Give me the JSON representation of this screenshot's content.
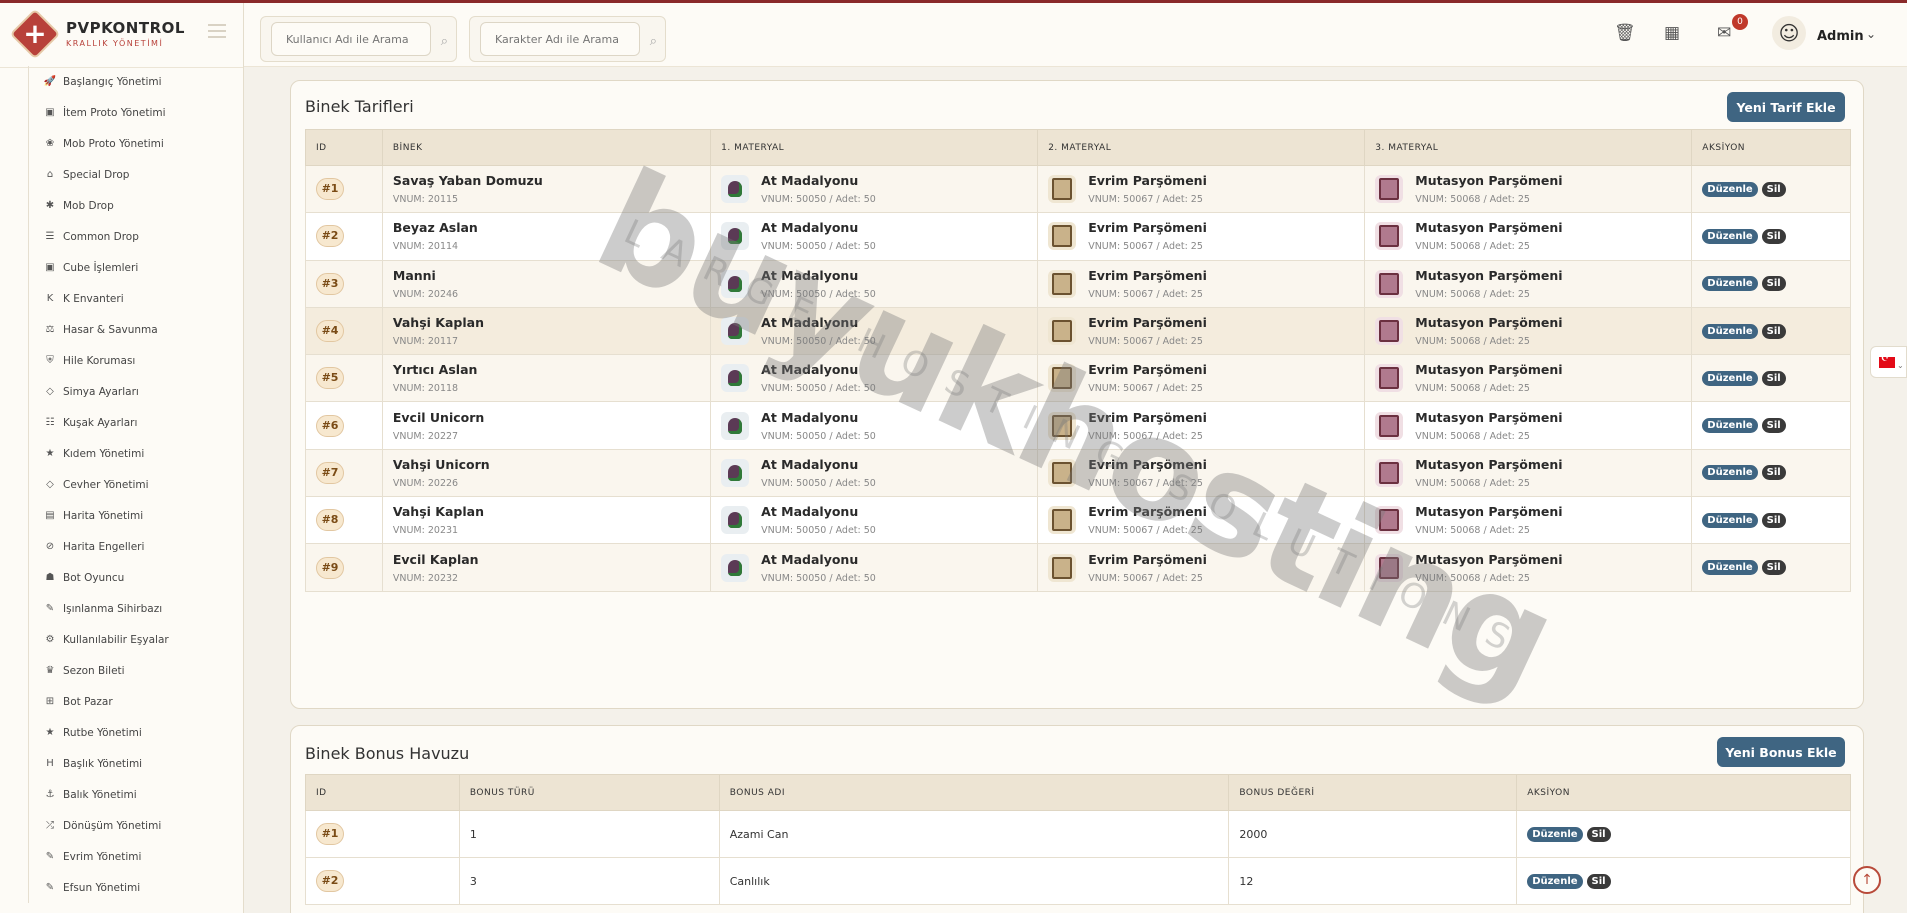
{
  "brand": {
    "name": "PVPKONTROL",
    "subtitle": "KRALLIK YÖNETİMİ"
  },
  "sidebar": {
    "items": [
      {
        "icon": "rocket-icon",
        "glyph": "🚀",
        "label": "Başlangıç Yönetimi"
      },
      {
        "icon": "box-icon",
        "glyph": "▣",
        "label": "İtem Proto Yönetimi"
      },
      {
        "icon": "paw-icon",
        "glyph": "❀",
        "label": "Mob Proto Yönetimi"
      },
      {
        "icon": "gift-icon",
        "glyph": "⌂",
        "label": "Special Drop"
      },
      {
        "icon": "bug-icon",
        "glyph": "✱",
        "label": "Mob Drop"
      },
      {
        "icon": "list-icon",
        "glyph": "☰",
        "label": "Common Drop"
      },
      {
        "icon": "cube-icon",
        "glyph": "▣",
        "label": "Cube İşlemleri"
      },
      {
        "icon": "k-icon",
        "glyph": "K",
        "label": "K Envanteri"
      },
      {
        "icon": "scale-icon",
        "glyph": "⚖",
        "label": "Hasar & Savunma"
      },
      {
        "icon": "shield-icon",
        "glyph": "⛨",
        "label": "Hile Koruması"
      },
      {
        "icon": "diamond-icon",
        "glyph": "◇",
        "label": "Simya Ayarları"
      },
      {
        "icon": "sliders-icon",
        "glyph": "☷",
        "label": "Kuşak Ayarları"
      },
      {
        "icon": "star-icon",
        "glyph": "★",
        "label": "Kıdem Yönetimi"
      },
      {
        "icon": "gem-icon",
        "glyph": "◇",
        "label": "Cevher Yönetimi"
      },
      {
        "icon": "map-icon",
        "glyph": "▤",
        "label": "Harita Yönetimi"
      },
      {
        "icon": "ban-icon",
        "glyph": "⊘",
        "label": "Harita Engelleri"
      },
      {
        "icon": "robot-icon",
        "glyph": "☗",
        "label": "Bot Oyuncu"
      },
      {
        "icon": "magic-wand-icon",
        "glyph": "✎",
        "label": "Işınlanma Sihirbazı"
      },
      {
        "icon": "cogs-icon",
        "glyph": "⚙",
        "label": "Kullanılabilir Eşyalar"
      },
      {
        "icon": "trophy-icon",
        "glyph": "♛",
        "label": "Sezon Bileti"
      },
      {
        "icon": "cart-icon",
        "glyph": "⊞",
        "label": "Bot Pazar"
      },
      {
        "icon": "star-icon",
        "glyph": "★",
        "label": "Rutbe Yönetimi"
      },
      {
        "icon": "heading-icon",
        "glyph": "H",
        "label": "Başlık Yönetimi"
      },
      {
        "icon": "anchor-icon",
        "glyph": "⚓",
        "label": "Balık Yönetimi"
      },
      {
        "icon": "random-icon",
        "glyph": "⤮",
        "label": "Dönüşüm Yönetimi"
      },
      {
        "icon": "wand-icon",
        "glyph": "✎",
        "label": "Evrim Yönetimi"
      },
      {
        "icon": "wand-icon",
        "glyph": "✎",
        "label": "Efsun Yönetimi"
      }
    ]
  },
  "header": {
    "search_user_placeholder": "Kullanıcı Adı ile Arama",
    "search_char_placeholder": "Karakter Adı ile Arama",
    "notification_count": "0",
    "user_name": "Admin"
  },
  "mount_recipes": {
    "title": "Binek Tarifleri",
    "add_button": "Yeni Tarif Ekle",
    "columns": [
      "ID",
      "BİNEK",
      "1. MATERYAL",
      "2. MATERYAL",
      "3. MATERYAL",
      "AKSİYON"
    ],
    "edit_label": "Düzenle",
    "delete_label": "Sil",
    "rows": [
      {
        "id": "#1",
        "mount": "Savaş Yaban Domuzu",
        "vnum": "VNUM: 20115",
        "m1": "At Madalyonu",
        "m1_sub": "VNUM: 50050 / Adet: 50",
        "m2": "Evrim Parşömeni",
        "m2_sub": "VNUM: 50067 / Adet: 25",
        "m3": "Mutasyon Parşömeni",
        "m3_sub": "VNUM: 50068 / Adet: 25"
      },
      {
        "id": "#2",
        "mount": "Beyaz Aslan",
        "vnum": "VNUM: 20114",
        "m1": "At Madalyonu",
        "m1_sub": "VNUM: 50050 / Adet: 50",
        "m2": "Evrim Parşömeni",
        "m2_sub": "VNUM: 50067 / Adet: 25",
        "m3": "Mutasyon Parşömeni",
        "m3_sub": "VNUM: 50068 / Adet: 25"
      },
      {
        "id": "#3",
        "mount": "Manni",
        "vnum": "VNUM: 20246",
        "m1": "At Madalyonu",
        "m1_sub": "VNUM: 50050 / Adet: 50",
        "m2": "Evrim Parşömeni",
        "m2_sub": "VNUM: 50067 / Adet: 25",
        "m3": "Mutasyon Parşömeni",
        "m3_sub": "VNUM: 50068 / Adet: 25"
      },
      {
        "id": "#4",
        "mount": "Vahşi Kaplan",
        "vnum": "VNUM: 20117",
        "m1": "At Madalyonu",
        "m1_sub": "VNUM: 50050 / Adet: 50",
        "m2": "Evrim Parşömeni",
        "m2_sub": "VNUM: 50067 / Adet: 25",
        "m3": "Mutasyon Parşömeni",
        "m3_sub": "VNUM: 50068 / Adet: 25"
      },
      {
        "id": "#5",
        "mount": "Yırtıcı Aslan",
        "vnum": "VNUM: 20118",
        "m1": "At Madalyonu",
        "m1_sub": "VNUM: 50050 / Adet: 50",
        "m2": "Evrim Parşömeni",
        "m2_sub": "VNUM: 50067 / Adet: 25",
        "m3": "Mutasyon Parşömeni",
        "m3_sub": "VNUM: 50068 / Adet: 25"
      },
      {
        "id": "#6",
        "mount": "Evcil Unicorn",
        "vnum": "VNUM: 20227",
        "m1": "At Madalyonu",
        "m1_sub": "VNUM: 50050 / Adet: 50",
        "m2": "Evrim Parşömeni",
        "m2_sub": "VNUM: 50067 / Adet: 25",
        "m3": "Mutasyon Parşömeni",
        "m3_sub": "VNUM: 50068 / Adet: 25"
      },
      {
        "id": "#7",
        "mount": "Vahşi Unicorn",
        "vnum": "VNUM: 20226",
        "m1": "At Madalyonu",
        "m1_sub": "VNUM: 50050 / Adet: 50",
        "m2": "Evrim Parşömeni",
        "m2_sub": "VNUM: 50067 / Adet: 25",
        "m3": "Mutasyon Parşömeni",
        "m3_sub": "VNUM: 50068 / Adet: 25"
      },
      {
        "id": "#8",
        "mount": "Vahşi Kaplan",
        "vnum": "VNUM: 20231",
        "m1": "At Madalyonu",
        "m1_sub": "VNUM: 50050 / Adet: 50",
        "m2": "Evrim Parşömeni",
        "m2_sub": "VNUM: 50067 / Adet: 25",
        "m3": "Mutasyon Parşömeni",
        "m3_sub": "VNUM: 50068 / Adet: 25"
      },
      {
        "id": "#9",
        "mount": "Evcil Kaplan",
        "vnum": "VNUM: 20232",
        "m1": "At Madalyonu",
        "m1_sub": "VNUM: 50050 / Adet: 50",
        "m2": "Evrim Parşömeni",
        "m2_sub": "VNUM: 50067 / Adet: 25",
        "m3": "Mutasyon Parşömeni",
        "m3_sub": "VNUM: 50068 / Adet: 25"
      }
    ]
  },
  "bonus_pool": {
    "title": "Binek Bonus Havuzu",
    "add_button": "Yeni Bonus Ekle",
    "columns": [
      "ID",
      "BONUS TÜRÜ",
      "BONUS ADI",
      "BONUS DEĞERİ",
      "AKSİYON"
    ],
    "rows": [
      {
        "id": "#1",
        "type": "1",
        "name": "Azami Can",
        "value": "2000"
      },
      {
        "id": "#2",
        "type": "3",
        "name": "Canlılık",
        "value": "12"
      }
    ]
  },
  "watermark": {
    "main": "buyukhosting",
    "sub": "LARGE HOSTING SOLUTIONS"
  },
  "colors": {
    "primary": "#3f6582",
    "accent": "#b8413a",
    "danger_dark": "#3a3a3a"
  }
}
